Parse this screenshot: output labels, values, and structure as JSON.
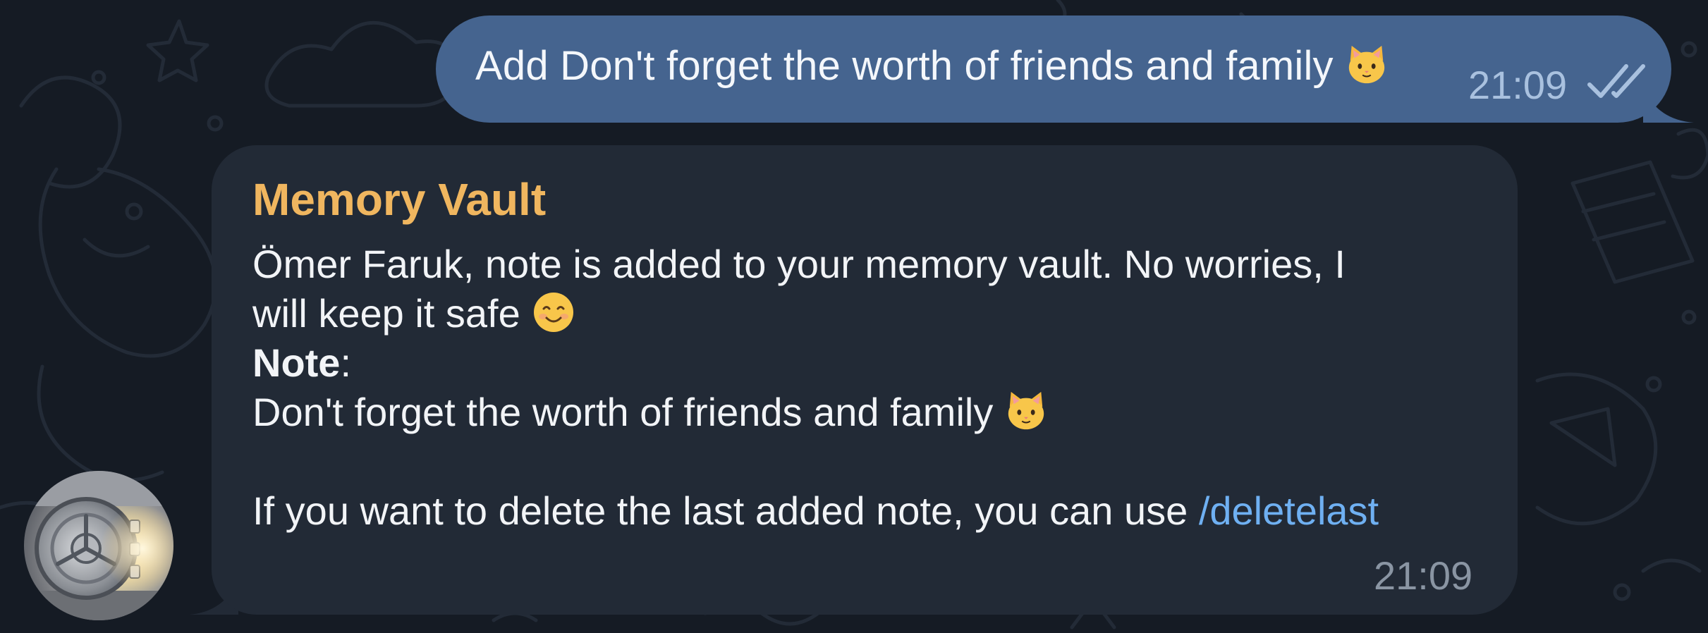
{
  "chat": {
    "outgoing": {
      "text": "Add Don't forget the worth of friends and family",
      "emoji": "cat-face-icon",
      "time": "21:09",
      "status_icon": "double-check-read-icon"
    },
    "incoming": {
      "sender": "Memory Vault",
      "line1": "Ömer Faruk, note is added to your memory vault. No worries, I",
      "line2": "will keep it safe",
      "line2_emoji": "smiling-face-icon",
      "note_label": "Note",
      "note_colon": ":",
      "note_text": "Don't forget the worth of friends and family",
      "note_emoji": "cat-face-icon",
      "delete_prefix": "If you want to delete the last added note, you can use ",
      "delete_command": "/deletelast",
      "time": "21:09",
      "avatar_icon": "vault-door-avatar"
    }
  },
  "colors": {
    "background": "#151b24",
    "outgoing_bubble": "#45648f",
    "incoming_bubble": "#222a36",
    "sender_name": "#f0b65f",
    "link": "#6fb0f2"
  }
}
